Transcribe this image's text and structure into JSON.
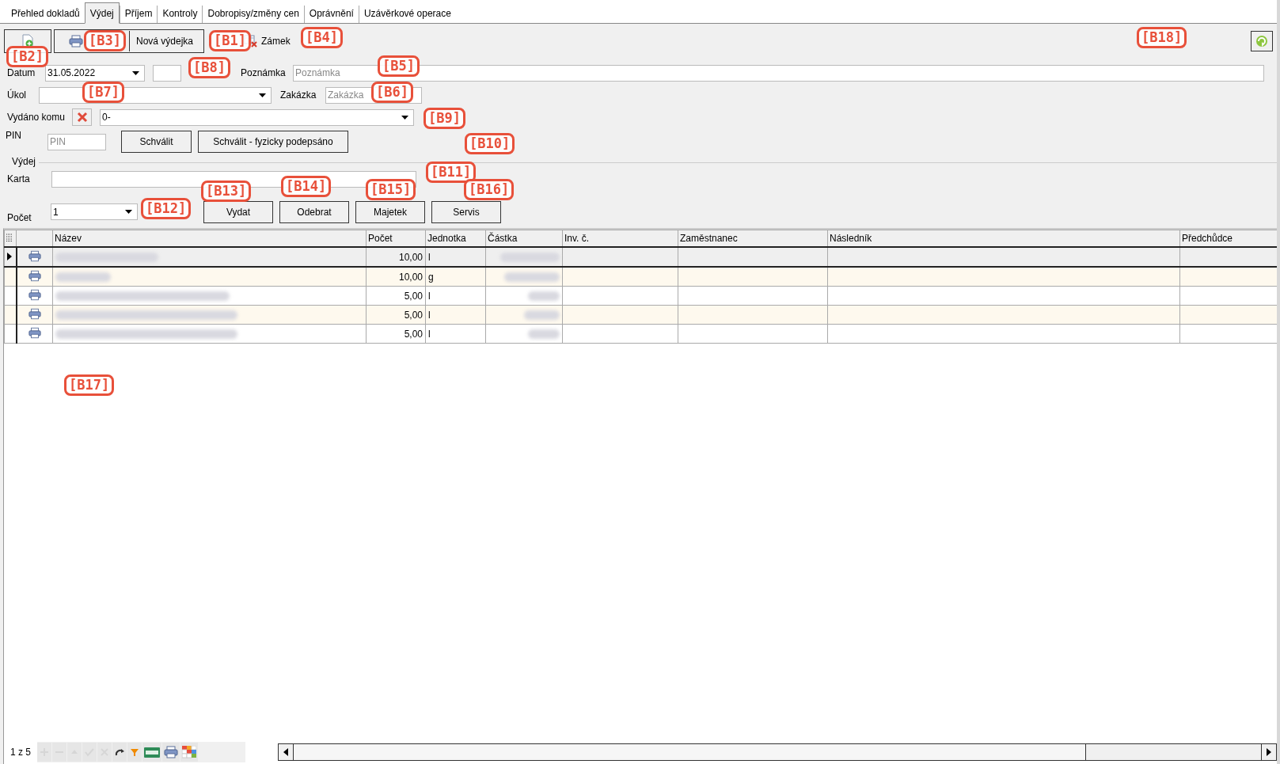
{
  "tabs": [
    {
      "label": "Přehled dokladů",
      "selected": false
    },
    {
      "label": "Výdej",
      "selected": true
    },
    {
      "label": "Příjem",
      "selected": false
    },
    {
      "label": "Kontroly",
      "selected": false
    },
    {
      "label": "Dobropisy/změny cen",
      "selected": false
    },
    {
      "label": "Oprávnění",
      "selected": false
    },
    {
      "label": "Uzávěrkové operace",
      "selected": false
    }
  ],
  "toolbar": {
    "new_issue_button": "Nová výdejka",
    "lock_label": "Zámek"
  },
  "form": {
    "date_label": "Datum",
    "date_value": "31.05.2022",
    "note_label": "Poznámka",
    "note_placeholder": "Poznámka",
    "task_label": "Úkol",
    "order_label": "Zakázka",
    "order_placeholder": "Zakázka",
    "issued_to_label": "Vydáno komu",
    "issued_to_value": "0-",
    "pin_label": "PIN",
    "pin_placeholder": "PIN",
    "approve_button": "Schválit",
    "approve_signed_button": "Schválit - fyzicky podepsáno",
    "group_label": "Výdej",
    "card_label": "Karta",
    "count_label": "Počet",
    "count_value": "1",
    "action_buttons": [
      "Vydat",
      "Odebrat",
      "Majetek",
      "Servis"
    ]
  },
  "grid": {
    "columns": [
      "Název",
      "Počet",
      "Jednotka",
      "Částka",
      "Inv. č.",
      "Zaměstnanec",
      "Následník",
      "Předchůdce"
    ],
    "rows": [
      {
        "selected": true,
        "quantity": "10,00",
        "unit": "l"
      },
      {
        "selected": false,
        "quantity": "10,00",
        "unit": "g"
      },
      {
        "selected": false,
        "quantity": "5,00",
        "unit": "l"
      },
      {
        "selected": false,
        "quantity": "5,00",
        "unit": "l"
      },
      {
        "selected": false,
        "quantity": "5,00",
        "unit": "l"
      }
    ]
  },
  "footer": {
    "record_count": "1 z 5",
    "tools": [
      {
        "kind": "add",
        "disabled": true
      },
      {
        "kind": "remove",
        "disabled": true
      },
      {
        "kind": "up",
        "disabled": true
      },
      {
        "kind": "confirm",
        "disabled": true
      },
      {
        "kind": "cancel",
        "disabled": true
      },
      {
        "kind": "redo",
        "disabled": false
      },
      {
        "kind": "filter",
        "disabled": false
      },
      {
        "kind": "excel",
        "disabled": false
      },
      {
        "kind": "print",
        "disabled": false
      },
      {
        "kind": "grid",
        "disabled": false
      }
    ]
  },
  "annotations": [
    "[B1]",
    "[B2]",
    "[B3]",
    "[B4]",
    "[B5]",
    "[B6]",
    "[B7]",
    "[B8]",
    "[B9]",
    "[B10]",
    "[B11]",
    "[B12]",
    "[B13]",
    "[B14]",
    "[B15]",
    "[B16]",
    "[B17]",
    "[B18]"
  ]
}
